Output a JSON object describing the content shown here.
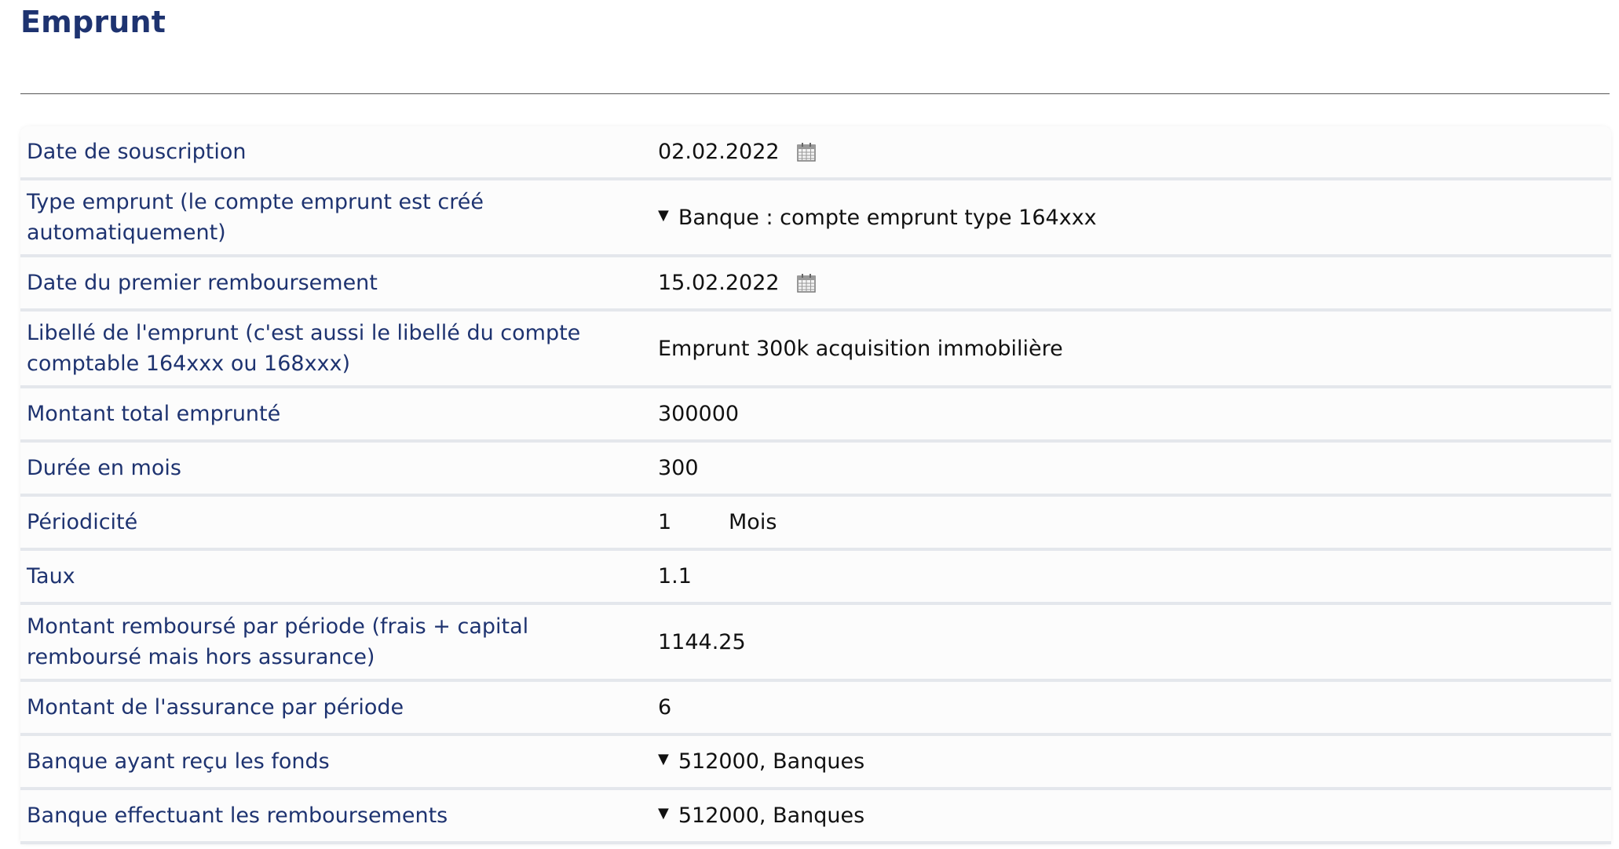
{
  "page": {
    "title": "Emprunt"
  },
  "form": {
    "date_souscription": {
      "label": "Date de souscription",
      "value": "02.02.2022",
      "icon": "calendar-icon"
    },
    "type_emprunt": {
      "label": "Type emprunt (le compte emprunt est créé automatiquement)",
      "value": "Banque : compte emprunt type 164xxx"
    },
    "date_premier_remboursement": {
      "label": "Date du premier remboursement",
      "value": "15.02.2022",
      "icon": "calendar-icon"
    },
    "libelle": {
      "label": "Libellé de l'emprunt (c'est aussi le libellé du compte comptable 164xxx ou 168xxx)",
      "value": "Emprunt 300k acquisition immobilière"
    },
    "montant_total": {
      "label": "Montant total emprunté",
      "value": "300000"
    },
    "duree_mois": {
      "label": "Durée en mois",
      "value": "300"
    },
    "periodicite": {
      "label": "Périodicité",
      "value": "1",
      "unit": "Mois"
    },
    "taux": {
      "label": "Taux",
      "value": "1.1"
    },
    "montant_par_periode": {
      "label": "Montant remboursé par période (frais + capital remboursé mais hors assurance)",
      "value": "1144.25"
    },
    "assurance_par_periode": {
      "label": "Montant de l'assurance par période",
      "value": "6"
    },
    "banque_fonds": {
      "label": "Banque ayant reçu les fonds",
      "value": "512000, Banques"
    },
    "banque_remboursements": {
      "label": "Banque effectuant les remboursements",
      "value": "512000, Banques"
    }
  },
  "colors": {
    "label_text": "#1e3370",
    "value_text": "#111111",
    "row_divider": "#e4e7ec",
    "card_background": "#fcfcfc"
  }
}
